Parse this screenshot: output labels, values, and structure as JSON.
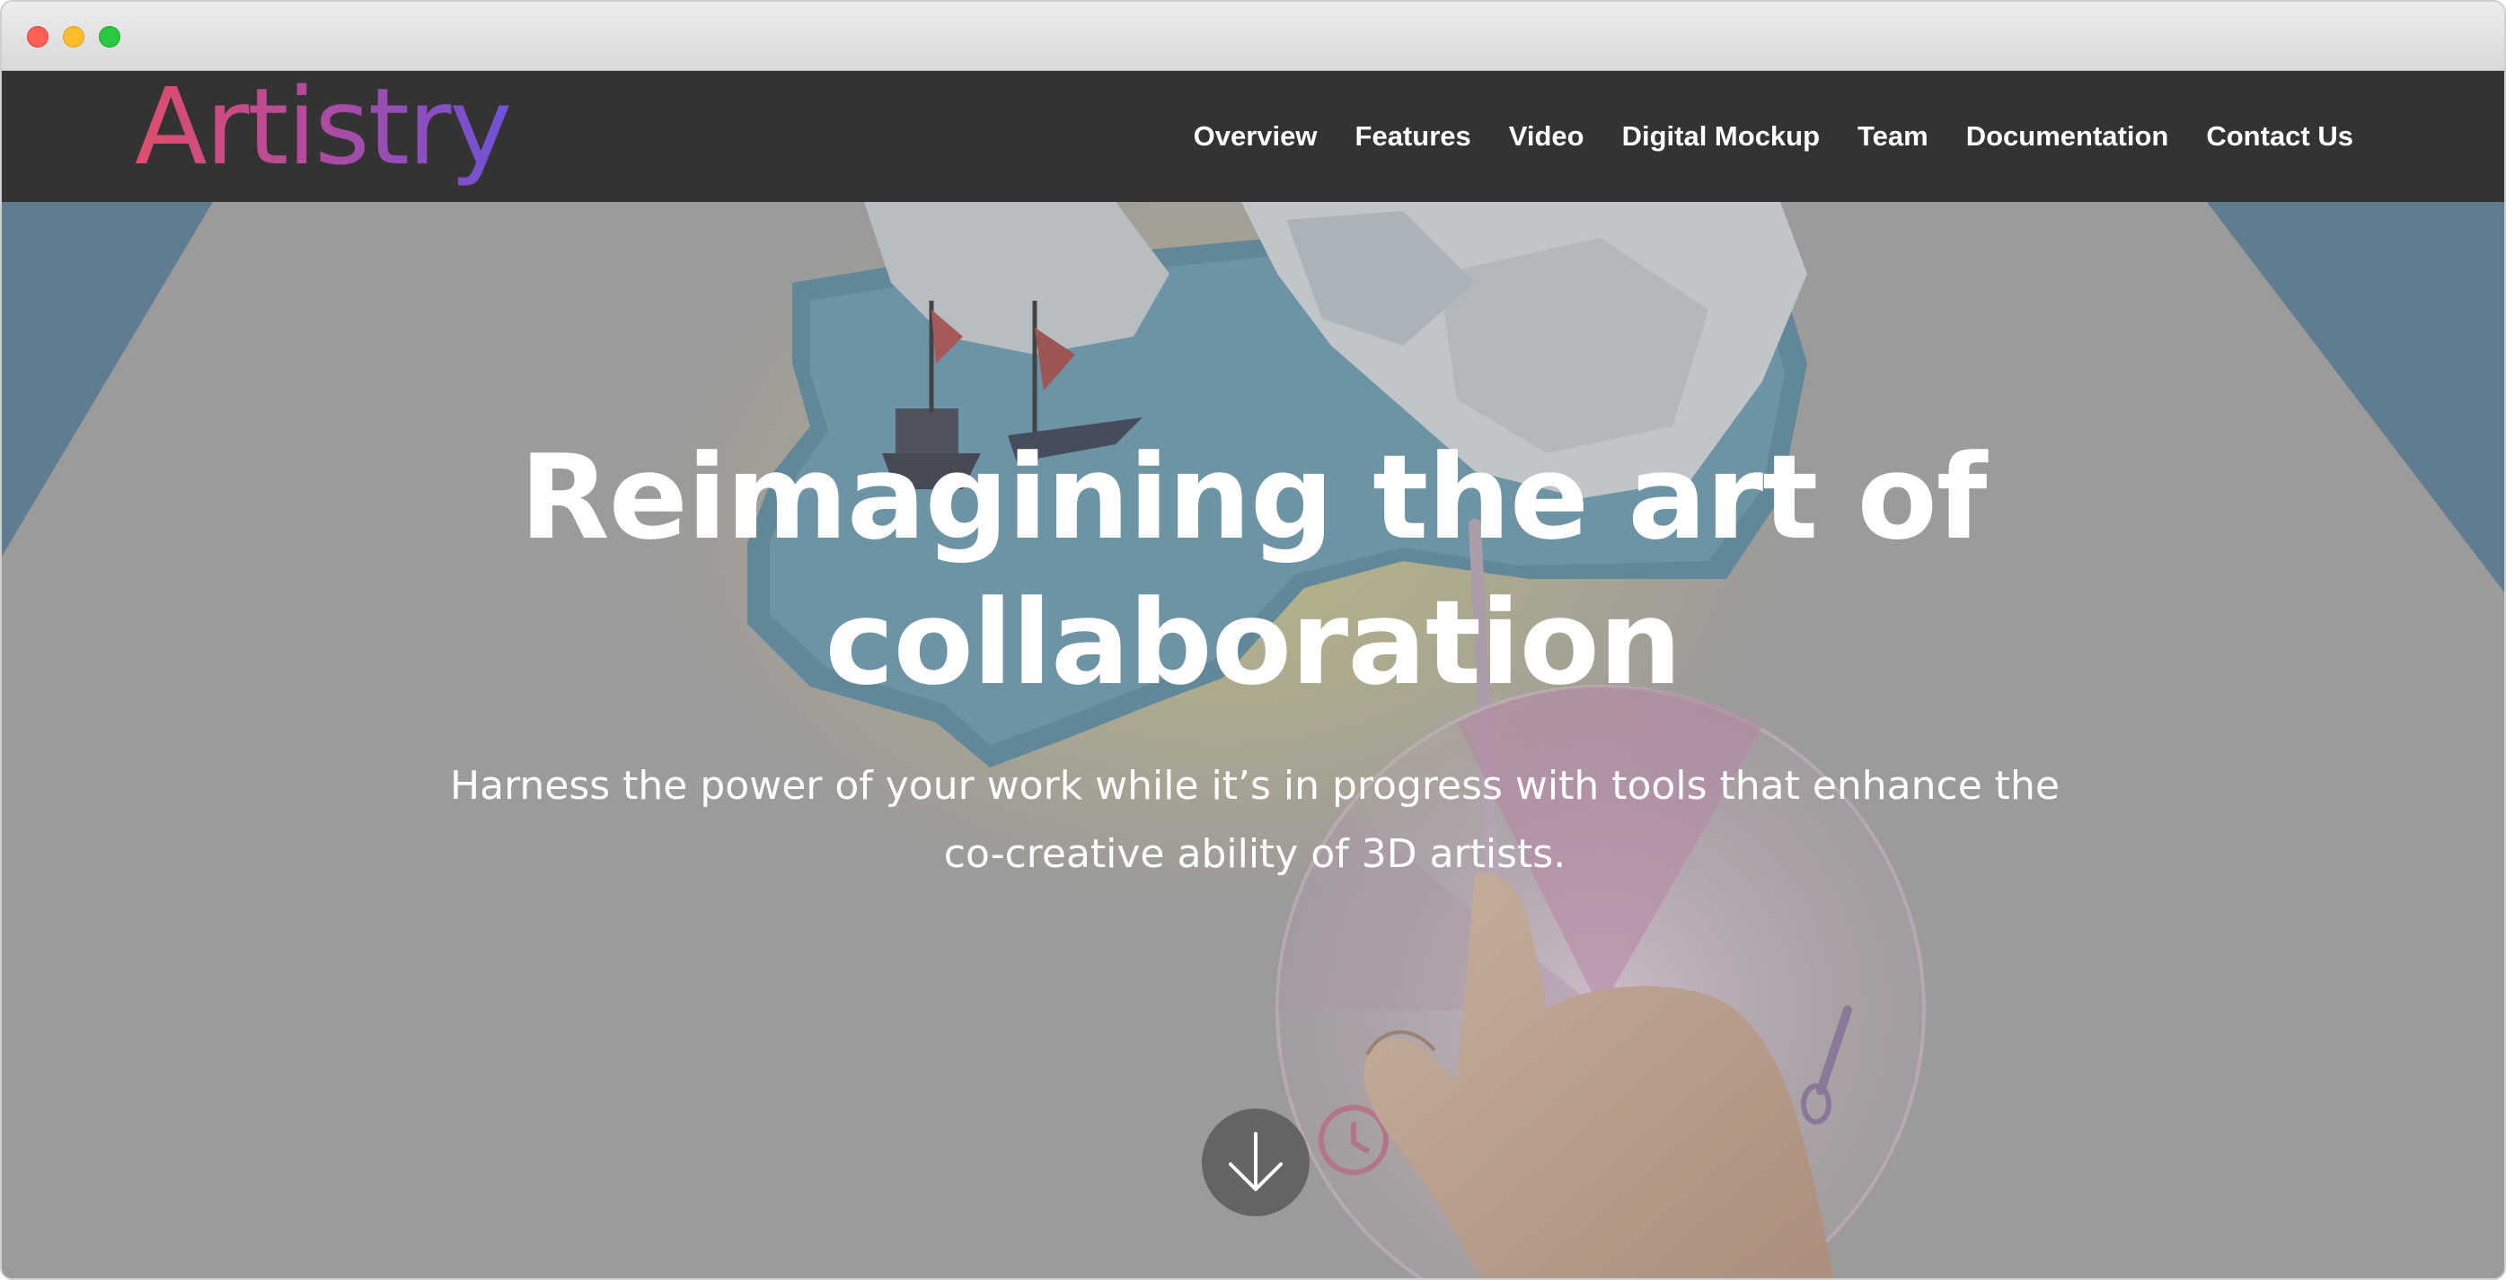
{
  "navbar": {
    "logo_text": "Artistry",
    "links": [
      {
        "label": "Overview"
      },
      {
        "label": "Features"
      },
      {
        "label": "Video"
      },
      {
        "label": "Digital Mockup"
      },
      {
        "label": "Team"
      },
      {
        "label": "Documentation"
      },
      {
        "label": "Contact Us"
      }
    ]
  },
  "hero": {
    "title_line1": "Reimagining the art of",
    "title_line2": "collaboration",
    "subtitle_line1": "Harness the power of your work while it’s in progress with tools that enhance the",
    "subtitle_line2": "co-creative ability of 3D artists.",
    "scroll_icon": "arrow-down-icon"
  },
  "colors": {
    "navbar_bg": "#333333",
    "logo_gradient_start": "#e04e6a",
    "logo_gradient_end": "#6e52d8",
    "text": "#ffffff"
  }
}
